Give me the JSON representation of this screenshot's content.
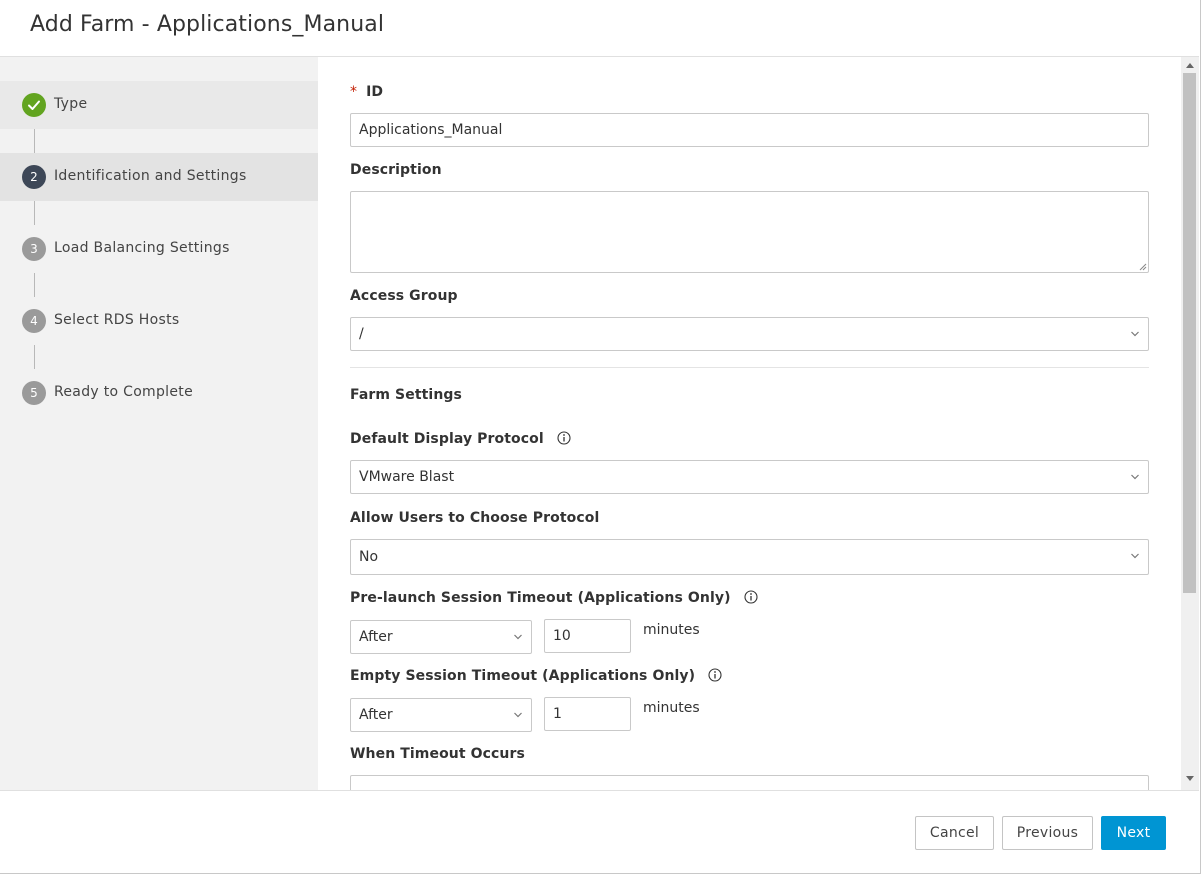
{
  "dialog": {
    "title": "Add Farm - Applications_Manual"
  },
  "steps": [
    {
      "number": "1",
      "label": "Type",
      "state": "done"
    },
    {
      "number": "2",
      "label": "Identification and Settings",
      "state": "current"
    },
    {
      "number": "3",
      "label": "Load Balancing Settings",
      "state": "future"
    },
    {
      "number": "4",
      "label": "Select RDS Hosts",
      "state": "future"
    },
    {
      "number": "5",
      "label": "Ready to Complete",
      "state": "future"
    }
  ],
  "form": {
    "id_required_mark": "*",
    "id_label": "ID",
    "id_value": "Applications_Manual",
    "description_label": "Description",
    "description_value": "",
    "access_group_label": "Access Group",
    "access_group_value": "/",
    "farm_settings_heading": "Farm Settings",
    "display_protocol_label": "Default Display Protocol",
    "display_protocol_value": "VMware Blast",
    "allow_choose_label": "Allow Users to Choose Protocol",
    "allow_choose_value": "No",
    "prelaunch_label": "Pre-launch Session Timeout (Applications Only)",
    "prelaunch_mode": "After",
    "prelaunch_minutes": "10",
    "prelaunch_unit": "minutes",
    "empty_label": "Empty Session Timeout (Applications Only)",
    "empty_mode": "After",
    "empty_minutes": "1",
    "empty_unit": "minutes",
    "when_timeout_label": "When Timeout Occurs"
  },
  "footer": {
    "cancel_label": "Cancel",
    "previous_label": "Previous",
    "next_label": "Next"
  },
  "colors": {
    "primary": "#0095d3",
    "step_done": "#62a420",
    "step_current": "#3d4757",
    "step_future": "#9a9a9a",
    "required": "#c21d00"
  }
}
